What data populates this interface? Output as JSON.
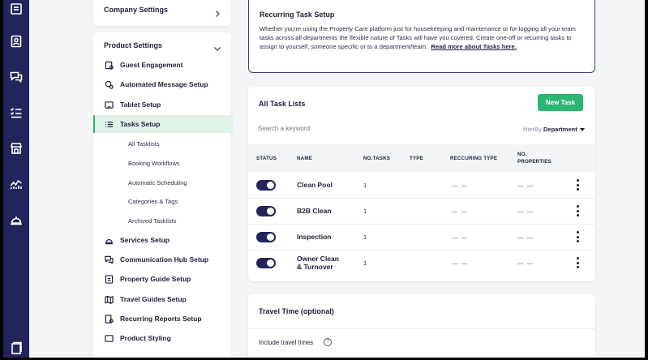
{
  "rail": {
    "icons": [
      "list-icon",
      "contacts-icon",
      "chat-icon",
      "checklist-icon",
      "store-icon",
      "analytics-icon",
      "service-bell-icon",
      "documents-icon"
    ]
  },
  "sidebar": {
    "company_settings": "Company Settings",
    "product_settings": "Product Settings",
    "items": [
      {
        "label": "Guest Engagement",
        "icon": "guest-settings-icon"
      },
      {
        "label": "Automated Message Setup",
        "icon": "automation-icon"
      },
      {
        "label": "Tablet Setup",
        "icon": "tablet-icon"
      },
      {
        "label": "Tasks Setup",
        "icon": "task-list-icon",
        "active": true
      },
      {
        "label": "Services Setup",
        "icon": "service-bell-icon"
      },
      {
        "label": "Communication Hub Setup",
        "icon": "chat-icon"
      },
      {
        "label": "Property Guide Setup",
        "icon": "guide-icon"
      },
      {
        "label": "Travel Guides Setup",
        "icon": "map-icon"
      },
      {
        "label": "Recurring Reports Setup",
        "icon": "reports-icon"
      },
      {
        "label": "Product Styling",
        "icon": "styling-icon"
      }
    ],
    "subitems": [
      "All Tasklists",
      "Booking Workflows",
      "Automatic Scheduling",
      "Categories & Tags",
      "Archived Tasklists"
    ]
  },
  "info": {
    "title": "Recurring Task Setup",
    "description": "Whether you're using the Property Care platform just for housekeeping and maintenance or for logging all your team tasks across all departments the flexible nature of Tasks will have you covered. Create one-off or recurring tasks to assign to yourself, someone specific or to a department/team.",
    "link": "Read more about Tasks here."
  },
  "tasks": {
    "title": "All Task Lists",
    "new_button": "New Task",
    "search_placeholder": "Search a keyword",
    "filter_label": "filterBy",
    "filter_value": "Department",
    "columns": {
      "status": "STATUS",
      "name": "NAME",
      "no_tasks": "NO.TASKS",
      "type": "TYPE",
      "recurring_type": "RECCURING TYPE",
      "no_properties_1": "NO.",
      "no_properties_2": "PROPERTIES"
    },
    "rows": [
      {
        "name_1": "Clean Pool",
        "name_2": "",
        "count": "1",
        "recurring": "— —",
        "properties": "— —",
        "enabled": true
      },
      {
        "name_1": "B2B Clean",
        "name_2": "",
        "count": "1",
        "recurring": "— —",
        "properties": "— —",
        "enabled": true
      },
      {
        "name_1": "Inspection",
        "name_2": "",
        "count": "1",
        "recurring": "— —",
        "properties": "— —",
        "enabled": true
      },
      {
        "name_1": "Owner Clean",
        "name_2": "& Turnover",
        "count": "1",
        "recurring": "— —",
        "properties": "— —",
        "enabled": true
      }
    ]
  },
  "travel": {
    "title": "Travel Time (optional)",
    "include_label": "Include travel times",
    "help": "?"
  },
  "colors": {
    "rail": "#22245b",
    "accent": "#2bb673",
    "active_bg": "#dff3e8"
  }
}
